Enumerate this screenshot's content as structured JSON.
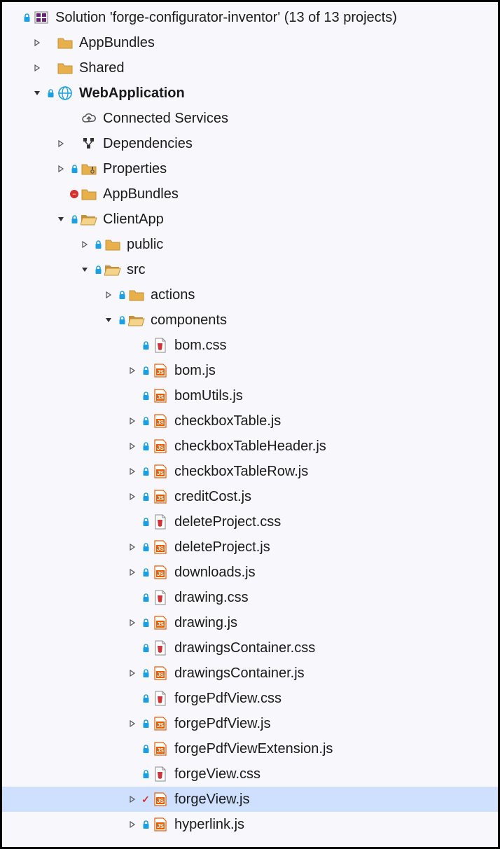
{
  "tree": [
    {
      "indent": 0,
      "arrow": "none",
      "lock": true,
      "badge": "none",
      "icon": "solution",
      "label": "Solution 'forge-configurator-inventor' (13 of 13 projects)",
      "bold": false
    },
    {
      "indent": 1,
      "arrow": "closed",
      "lock": false,
      "badge": "none",
      "icon": "folder",
      "label": "AppBundles",
      "bold": false
    },
    {
      "indent": 1,
      "arrow": "closed",
      "lock": false,
      "badge": "none",
      "icon": "folder",
      "label": "Shared",
      "bold": false
    },
    {
      "indent": 1,
      "arrow": "open",
      "lock": true,
      "badge": "none",
      "icon": "webproj",
      "label": "WebApplication",
      "bold": true
    },
    {
      "indent": 2,
      "arrow": "none",
      "lock": false,
      "badge": "none",
      "icon": "cloud",
      "label": "Connected Services",
      "bold": false
    },
    {
      "indent": 2,
      "arrow": "closed",
      "lock": false,
      "badge": "none",
      "icon": "deps",
      "label": "Dependencies",
      "bold": false
    },
    {
      "indent": 2,
      "arrow": "closed",
      "lock": true,
      "badge": "none",
      "icon": "folder-wrench",
      "label": "Properties",
      "bold": false
    },
    {
      "indent": 2,
      "arrow": "none",
      "lock": false,
      "badge": "red-dot",
      "icon": "folder",
      "label": "AppBundles",
      "bold": false
    },
    {
      "indent": 2,
      "arrow": "open",
      "lock": true,
      "badge": "none",
      "icon": "folder-open",
      "label": "ClientApp",
      "bold": false
    },
    {
      "indent": 3,
      "arrow": "closed",
      "lock": true,
      "badge": "none",
      "icon": "folder",
      "label": "public",
      "bold": false
    },
    {
      "indent": 3,
      "arrow": "open",
      "lock": true,
      "badge": "none",
      "icon": "folder-open",
      "label": "src",
      "bold": false
    },
    {
      "indent": 4,
      "arrow": "closed",
      "lock": true,
      "badge": "none",
      "icon": "folder",
      "label": "actions",
      "bold": false
    },
    {
      "indent": 4,
      "arrow": "open",
      "lock": true,
      "badge": "none",
      "icon": "folder-open",
      "label": "components",
      "bold": false
    },
    {
      "indent": 5,
      "arrow": "none",
      "lock": true,
      "badge": "none",
      "icon": "css",
      "label": "bom.css",
      "bold": false
    },
    {
      "indent": 5,
      "arrow": "closed",
      "lock": true,
      "badge": "none",
      "icon": "js",
      "label": "bom.js",
      "bold": false
    },
    {
      "indent": 5,
      "arrow": "none",
      "lock": true,
      "badge": "none",
      "icon": "js",
      "label": "bomUtils.js",
      "bold": false
    },
    {
      "indent": 5,
      "arrow": "closed",
      "lock": true,
      "badge": "none",
      "icon": "js",
      "label": "checkboxTable.js",
      "bold": false
    },
    {
      "indent": 5,
      "arrow": "closed",
      "lock": true,
      "badge": "none",
      "icon": "js",
      "label": "checkboxTableHeader.js",
      "bold": false
    },
    {
      "indent": 5,
      "arrow": "closed",
      "lock": true,
      "badge": "none",
      "icon": "js",
      "label": "checkboxTableRow.js",
      "bold": false
    },
    {
      "indent": 5,
      "arrow": "closed",
      "lock": true,
      "badge": "none",
      "icon": "js",
      "label": "creditCost.js",
      "bold": false
    },
    {
      "indent": 5,
      "arrow": "none",
      "lock": true,
      "badge": "none",
      "icon": "css",
      "label": "deleteProject.css",
      "bold": false
    },
    {
      "indent": 5,
      "arrow": "closed",
      "lock": true,
      "badge": "none",
      "icon": "js",
      "label": "deleteProject.js",
      "bold": false
    },
    {
      "indent": 5,
      "arrow": "closed",
      "lock": true,
      "badge": "none",
      "icon": "js",
      "label": "downloads.js",
      "bold": false
    },
    {
      "indent": 5,
      "arrow": "none",
      "lock": true,
      "badge": "none",
      "icon": "css",
      "label": "drawing.css",
      "bold": false
    },
    {
      "indent": 5,
      "arrow": "closed",
      "lock": true,
      "badge": "none",
      "icon": "js",
      "label": "drawing.js",
      "bold": false
    },
    {
      "indent": 5,
      "arrow": "none",
      "lock": true,
      "badge": "none",
      "icon": "css",
      "label": "drawingsContainer.css",
      "bold": false
    },
    {
      "indent": 5,
      "arrow": "closed",
      "lock": true,
      "badge": "none",
      "icon": "js",
      "label": "drawingsContainer.js",
      "bold": false
    },
    {
      "indent": 5,
      "arrow": "none",
      "lock": true,
      "badge": "none",
      "icon": "css",
      "label": "forgePdfView.css",
      "bold": false
    },
    {
      "indent": 5,
      "arrow": "closed",
      "lock": true,
      "badge": "none",
      "icon": "js",
      "label": "forgePdfView.js",
      "bold": false
    },
    {
      "indent": 5,
      "arrow": "none",
      "lock": true,
      "badge": "none",
      "icon": "js",
      "label": "forgePdfViewExtension.js",
      "bold": false
    },
    {
      "indent": 5,
      "arrow": "none",
      "lock": true,
      "badge": "none",
      "icon": "css",
      "label": "forgeView.css",
      "bold": false
    },
    {
      "indent": 5,
      "arrow": "closed",
      "lock": false,
      "badge": "red-check",
      "icon": "js",
      "label": "forgeView.js",
      "bold": false,
      "selected": true
    },
    {
      "indent": 5,
      "arrow": "closed",
      "lock": true,
      "badge": "none",
      "icon": "js",
      "label": "hyperlink.js",
      "bold": false
    }
  ]
}
